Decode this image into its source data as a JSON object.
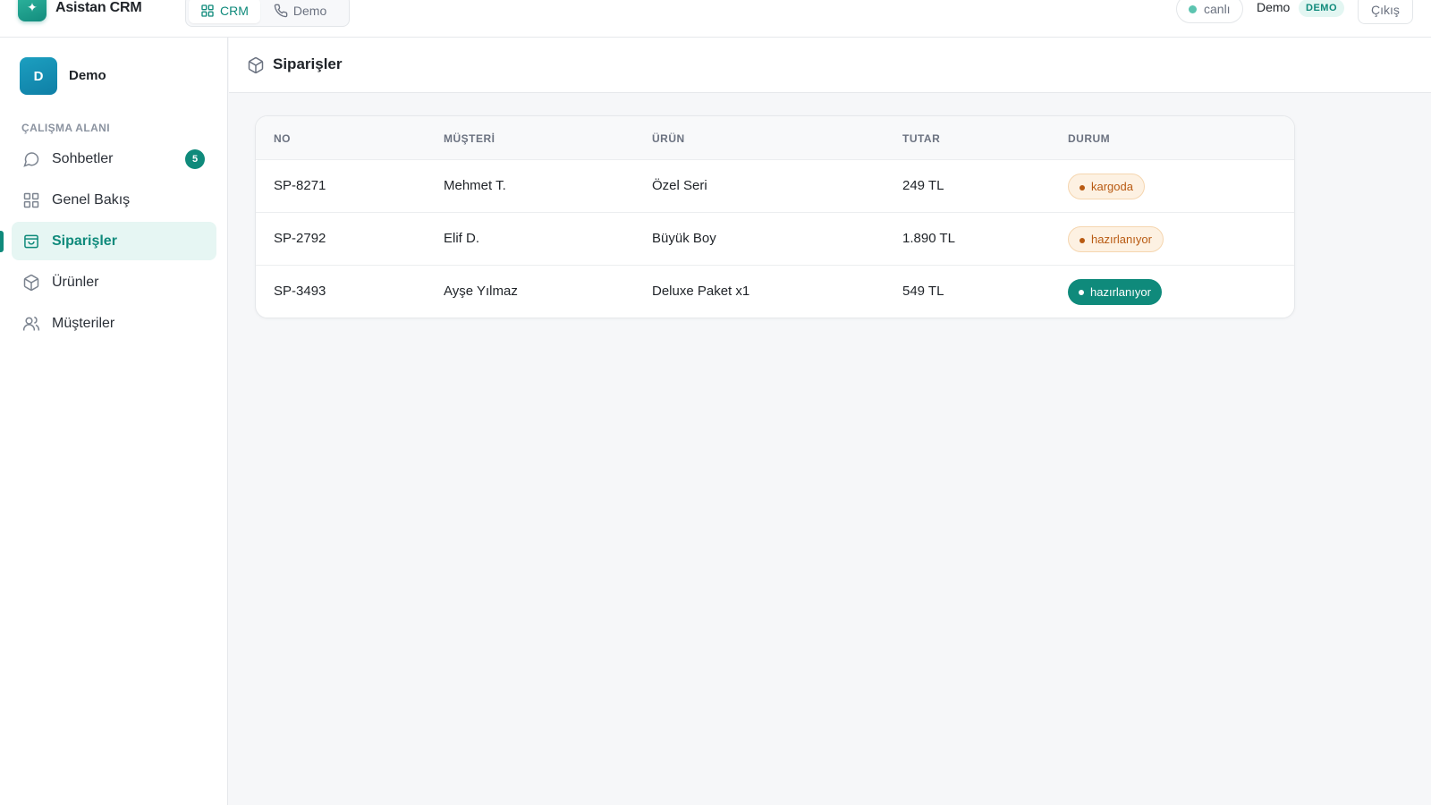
{
  "app": {
    "title": "Asistan CRM",
    "logo_glyph": "✦"
  },
  "top_tabs": [
    {
      "label": "CRM",
      "icon": "grid-icon",
      "active": true
    },
    {
      "label": "Demo",
      "icon": "phone-icon",
      "active": false
    }
  ],
  "status": {
    "label": "canlı",
    "dot_color": "#5cc4b0"
  },
  "user": {
    "name": "Demo",
    "badge": "DEMO"
  },
  "logout_label": "Çıkış",
  "workspace": {
    "initial": "D",
    "name": "Demo"
  },
  "sidebar": {
    "section_label": "ÇALIŞMA ALANI",
    "items": [
      {
        "label": "Sohbetler",
        "icon": "chat-icon",
        "badge": "5"
      },
      {
        "label": "Genel Bakış",
        "icon": "grid-icon"
      },
      {
        "label": "Siparişler",
        "icon": "shopping-bag-icon",
        "active": true
      },
      {
        "label": "Ürünler",
        "icon": "box-icon"
      },
      {
        "label": "Müşteriler",
        "icon": "users-icon"
      }
    ]
  },
  "page": {
    "title": "Siparişler",
    "icon": "box-icon"
  },
  "table": {
    "columns": [
      "NO",
      "MÜŞTERİ",
      "ÜRÜN",
      "TUTAR",
      "DURUM"
    ],
    "rows": [
      {
        "no": "SP-8271",
        "customer": "Mehmet T.",
        "product": "Özel Seri",
        "amount": "249 TL",
        "status": "kargoda",
        "status_style": "warn"
      },
      {
        "no": "SP-2792",
        "customer": "Elif D.",
        "product": "Büyük Boy",
        "amount": "1.890 TL",
        "status": "hazırlanıyor",
        "status_style": "warn"
      },
      {
        "no": "SP-3493",
        "customer": "Ayşe Yılmaz",
        "product": "Deluxe Paket x1",
        "amount": "549 TL",
        "status": "hazırlanıyor",
        "status_style": "ok"
      }
    ]
  },
  "colors": {
    "accent": "#0f8a7b",
    "warn_bg": "#fdf1e2",
    "warn_text": "#b85a12"
  }
}
